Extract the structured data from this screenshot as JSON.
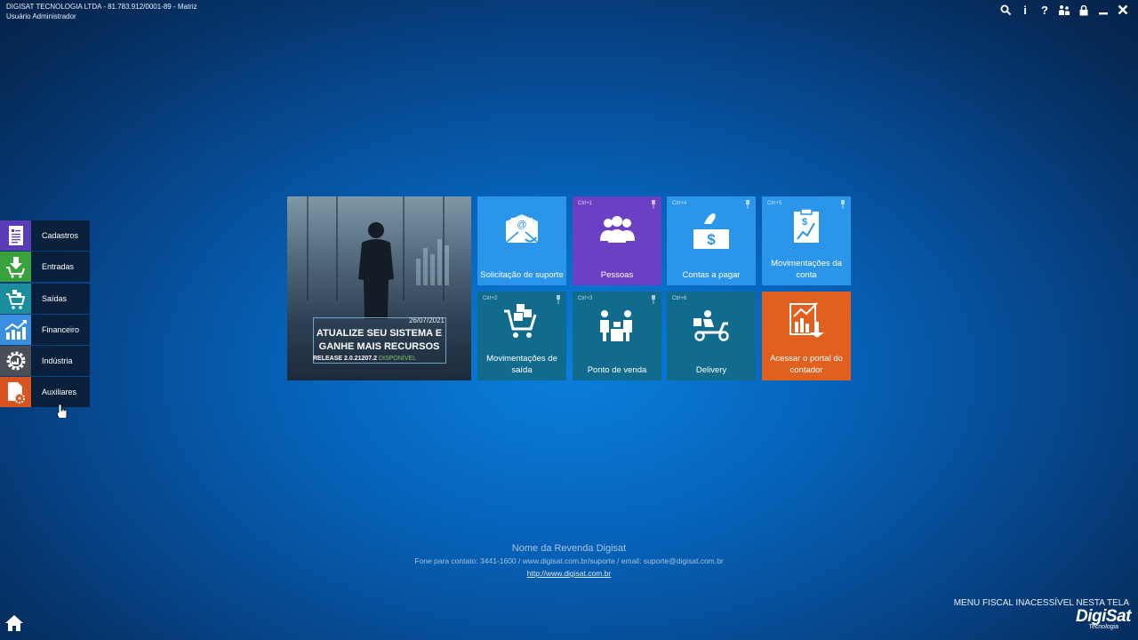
{
  "header": {
    "company": "DIGISAT TECNOLOGIA LTDA - 81.783.912/0001-89 - Matriz",
    "user": "Usuário Administrador",
    "icons": [
      "search-icon",
      "info-icon",
      "help-icon",
      "users-icon",
      "lock-icon",
      "minimize-icon",
      "close-icon"
    ]
  },
  "sidemenu": {
    "items": [
      {
        "label": "Cadastros",
        "color": "#5b3bb6",
        "icon": "document-list-icon"
      },
      {
        "label": "Entradas",
        "color": "#3aa23a",
        "icon": "cart-in-icon"
      },
      {
        "label": "Saídas",
        "color": "#1a8e9e",
        "icon": "cart-out-icon"
      },
      {
        "label": "Financeiro",
        "color": "#3a8fe0",
        "icon": "chart-up-icon"
      },
      {
        "label": "Indústria",
        "color": "#4a4f57",
        "icon": "gear-factory-icon"
      },
      {
        "label": "Auxiliares",
        "color": "#d9541e",
        "icon": "document-gear-icon"
      }
    ]
  },
  "banner": {
    "date": "26/07/2021",
    "headline_line1": "ATUALIZE SEU SISTEMA E",
    "headline_line2": "GANHE MAIS RECURSOS",
    "release": "RELEASE 2.0.21207.2",
    "status": "DISPONÍVEL"
  },
  "tiles": [
    {
      "label": "Solicitação de suporte",
      "shortcut": "",
      "color": "#2b95ea",
      "icon": "email-support-icon"
    },
    {
      "label": "Pessoas",
      "shortcut": "Ctrl+1",
      "color": "#6c40c4",
      "icon": "people-icon"
    },
    {
      "label": "Contas a pagar",
      "shortcut": "Ctrl+4",
      "color": "#2b95ea",
      "icon": "pay-hand-icon"
    },
    {
      "label": "Movimentações da conta",
      "shortcut": "Ctrl+5",
      "color": "#2b95ea",
      "icon": "account-chart-icon"
    },
    {
      "label": "Movimentações de saída",
      "shortcut": "Ctrl+2",
      "color": "#116b8c",
      "icon": "cart-boxes-icon"
    },
    {
      "label": "Ponto de venda",
      "shortcut": "Ctrl+3",
      "color": "#116b8c",
      "icon": "point-of-sale-icon"
    },
    {
      "label": "Delivery",
      "shortcut": "Ctrl+6",
      "color": "#116b8c",
      "icon": "delivery-scooter-icon"
    },
    {
      "label": "Acessar o portal do contador",
      "shortcut": "",
      "color": "#e0601f",
      "icon": "accountant-portal-icon"
    }
  ],
  "footer": {
    "revenda": "Nome da Revenda Digisat",
    "contato": "Fone para contato: 3441-1600 / www.digisat.com.br/suporte / email: suporte@digisat.com.br",
    "site": "http://www.digisat.com.br"
  },
  "fiscal_notice": "MENU FISCAL INACESSÍVEL NESTA TELA",
  "logo": {
    "brand": "DigiSat",
    "sub": "Tecnologia"
  }
}
